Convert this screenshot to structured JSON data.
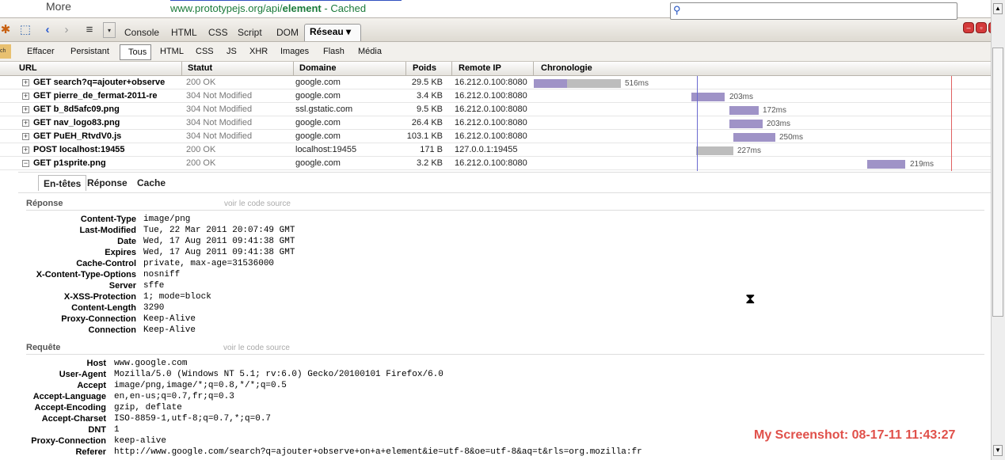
{
  "browser": {
    "more_label": "More",
    "cached_url_prefix": "www.prototypejs.org/api/",
    "cached_url_bold": "element",
    "cached_suffix": " - Cached"
  },
  "toolbar": {
    "tabs": [
      "Console",
      "HTML",
      "CSS",
      "Script",
      "DOM"
    ],
    "active_tab": "Réseau ▾",
    "search_value": ""
  },
  "filters": {
    "clear": "Effacer",
    "persist": "Persistant",
    "items": [
      "Tous",
      "HTML",
      "CSS",
      "JS",
      "XHR",
      "Images",
      "Flash",
      "Média"
    ]
  },
  "columns": [
    "URL",
    "Statut",
    "Domaine",
    "Poids",
    "Remote IP",
    "Chronologie"
  ],
  "requests": [
    {
      "expander": "+",
      "url": "GET search?q=ajouter+observe",
      "status": "200 OK",
      "domain": "google.com",
      "size": "29.5 KB",
      "ip": "16.212.0.100:8080",
      "time": "516ms"
    },
    {
      "expander": "+",
      "url": "GET pierre_de_fermat-2011-re",
      "status": "304 Not Modified",
      "domain": "google.com",
      "size": "3.4 KB",
      "ip": "16.212.0.100:8080",
      "time": "203ms"
    },
    {
      "expander": "+",
      "url": "GET b_8d5afc09.png",
      "status": "304 Not Modified",
      "domain": "ssl.gstatic.com",
      "size": "9.5 KB",
      "ip": "16.212.0.100:8080",
      "time": "172ms"
    },
    {
      "expander": "+",
      "url": "GET nav_logo83.png",
      "status": "304 Not Modified",
      "domain": "google.com",
      "size": "26.4 KB",
      "ip": "16.212.0.100:8080",
      "time": "203ms"
    },
    {
      "expander": "+",
      "url": "GET PuEH_RtvdV0.js",
      "status": "304 Not Modified",
      "domain": "google.com",
      "size": "103.1 KB",
      "ip": "16.212.0.100:8080",
      "time": "250ms"
    },
    {
      "expander": "+",
      "url": "POST localhost:19455",
      "status": "200 OK",
      "domain": "localhost:19455",
      "size": "171 B",
      "ip": "127.0.0.1:19455",
      "time": "227ms"
    },
    {
      "expander": "−",
      "url": "GET p1sprite.png",
      "status": "200 OK",
      "domain": "google.com",
      "size": "3.2 KB",
      "ip": "16.212.0.100:8080",
      "time": "219ms"
    }
  ],
  "detail": {
    "tabs": [
      "En-têtes",
      "Réponse",
      "Cache"
    ],
    "response_title": "Réponse",
    "view_source": "voir le code source",
    "response_headers": [
      {
        "k": "Content-Type",
        "v": "image/png"
      },
      {
        "k": "Last-Modified",
        "v": "Tue, 22 Mar 2011 20:07:49 GMT"
      },
      {
        "k": "Date",
        "v": "Wed, 17 Aug 2011 09:41:38 GMT"
      },
      {
        "k": "Expires",
        "v": "Wed, 17 Aug 2011 09:41:38 GMT"
      },
      {
        "k": "Cache-Control",
        "v": "private, max-age=31536000"
      },
      {
        "k": "X-Content-Type-Options",
        "v": "nosniff"
      },
      {
        "k": "Server",
        "v": "sffe"
      },
      {
        "k": "X-XSS-Protection",
        "v": "1; mode=block"
      },
      {
        "k": "Content-Length",
        "v": "3290"
      },
      {
        "k": "Proxy-Connection",
        "v": "Keep-Alive"
      },
      {
        "k": "Connection",
        "v": "Keep-Alive"
      }
    ],
    "request_title": "Requête",
    "request_headers": [
      {
        "k": "Host",
        "v": "www.google.com"
      },
      {
        "k": "User-Agent",
        "v": "Mozilla/5.0 (Windows NT 5.1; rv:6.0) Gecko/20100101 Firefox/6.0"
      },
      {
        "k": "Accept",
        "v": "image/png,image/*;q=0.8,*/*;q=0.5"
      },
      {
        "k": "Accept-Language",
        "v": "en,en-us;q=0.7,fr;q=0.3"
      },
      {
        "k": "Accept-Encoding",
        "v": "gzip, deflate"
      },
      {
        "k": "Accept-Charset",
        "v": "ISO-8859-1,utf-8;q=0.7,*;q=0.7"
      },
      {
        "k": "DNT",
        "v": "1"
      },
      {
        "k": "Proxy-Connection",
        "v": "keep-alive"
      },
      {
        "k": "Referer",
        "v": "http://www.google.com/search?q=ajouter+observe+on+a+element&ie=utf-8&oe=utf-8&aq=t&rls=org.mozilla:fr"
      }
    ]
  },
  "watermark": "My Screenshot: 08-17-11 11:43:27"
}
